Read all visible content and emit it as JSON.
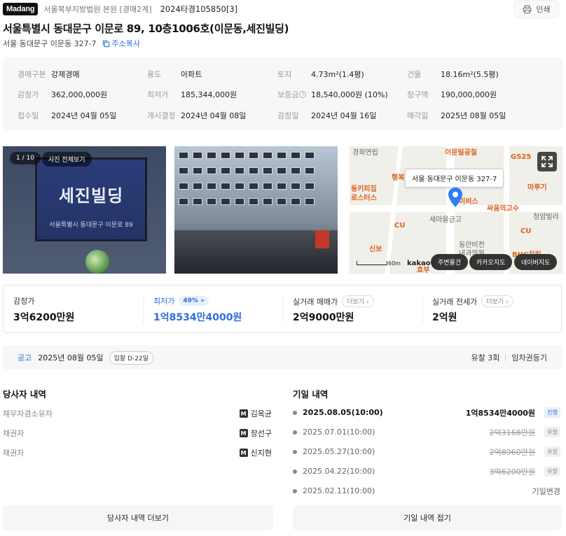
{
  "header": {
    "logo": "Madang",
    "court": "서울북부지방법원 본원 [경매2계]",
    "case_no": "2024타경105850[3]",
    "print_label": "인쇄"
  },
  "property": {
    "title": "서울특별시 동대문구 이문로 89, 10층1006호(이문동,세진빌딩)",
    "lot_address": "서울 동대문구 이문동 327-7",
    "copy_label": "주소복사"
  },
  "info": [
    {
      "label": "경매구분",
      "value": "강제경매"
    },
    {
      "label": "용도",
      "value": "아파트"
    },
    {
      "label": "토지",
      "value": "4.73m²(1.4평)"
    },
    {
      "label": "건물",
      "value": "18.16m²(5.5평)"
    },
    {
      "label": "감정가",
      "value": "362,000,000원"
    },
    {
      "label": "최저가",
      "value": "185,344,000원"
    },
    {
      "label": "보증금",
      "value": "18,540,000원 (10%)"
    },
    {
      "label": "청구액",
      "value": "190,000,000원"
    },
    {
      "label": "접수일",
      "value": "2024년 04월 05일"
    },
    {
      "label": "개시결정",
      "value": "2024년 04월 08일"
    },
    {
      "label": "감정일",
      "value": "2024년 04월 16일"
    },
    {
      "label": "매각일",
      "value": "2025년 08월 05일"
    }
  ],
  "gallery": {
    "counter": "1 / 10",
    "view_all": "사진 전체보기",
    "sign_text": "세진빌딩",
    "sign_sub": "서울특별시 동대문구 이문로 89"
  },
  "map": {
    "tooltip": "서울 동대문구 이문동 327-7",
    "labels": [
      "경희연립",
      "이문일공칠",
      "GS25",
      "행복",
      "동키피집",
      "로스터스",
      "이비스",
      "마루기",
      "싸움의고수",
      "새마을금고",
      "CU",
      "CU",
      "청암빌라",
      "신보",
      "동안비전",
      "내과의원",
      "BHC치킨",
      "효부"
    ],
    "scale": "60m",
    "brand": "kakao",
    "buttons": [
      "주변물건",
      "카카오지도",
      "네이버지도"
    ]
  },
  "prices": [
    {
      "label": "감정가",
      "value": "3억6200만원"
    },
    {
      "label": "최저가",
      "badge": "49%",
      "value": "1억8534만4000원"
    },
    {
      "label": "실거래 매매가",
      "more": "더보기",
      "value": "2억9000만원"
    },
    {
      "label": "실거래 전세가",
      "more": "더보기",
      "value": "2억원"
    }
  ],
  "notice": {
    "label": "공고",
    "date": "2025년 08월 05일",
    "dday": "입찰 D-22일",
    "fail_count": "유찰 3회",
    "register_label": "임차권등기"
  },
  "parties": {
    "title": "당사자 내역",
    "rows": [
      {
        "role": "채무자겸소유자",
        "name": "김옥균"
      },
      {
        "role": "채권자",
        "name": "장선구"
      },
      {
        "role": "채권자",
        "name": "신지현"
      }
    ],
    "more_button": "당사자 내역 더보기"
  },
  "history": {
    "title": "기일 내역",
    "rows": [
      {
        "date": "2025.08.05(10:00)",
        "price": "1억8534만4000원",
        "status": "진행"
      },
      {
        "date": "2025.07.01(10:00)",
        "price": "2억3168만원",
        "status": "유찰"
      },
      {
        "date": "2025.05.27(10:00)",
        "price": "2억8960만원",
        "status": "유찰"
      },
      {
        "date": "2025.04.22(10:00)",
        "price": "3억6200만원",
        "status": "유찰"
      },
      {
        "date": "2025.02.11(10:00)",
        "price": "",
        "status": "기일변경"
      }
    ],
    "fold_button": "기일 내역 접기"
  },
  "colors": {
    "accent": "#2f6fdb",
    "muted": "#999999",
    "panel": "#f6f7f9"
  }
}
